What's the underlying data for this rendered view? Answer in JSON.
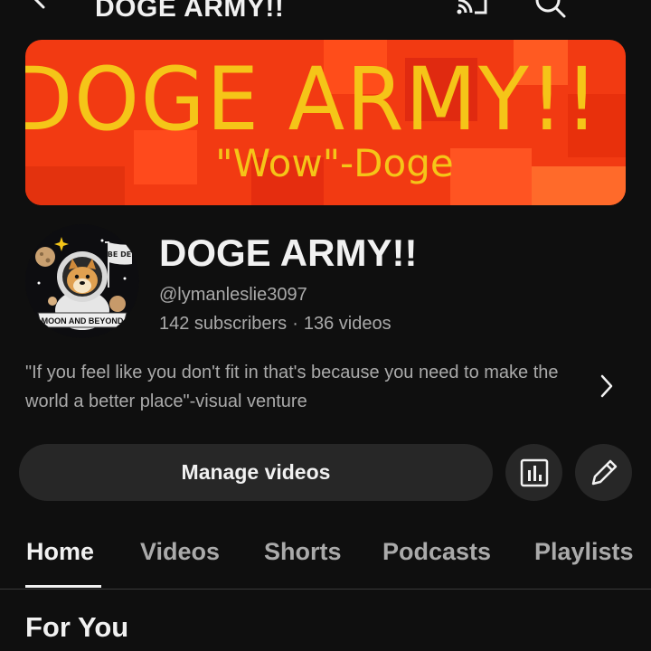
{
  "topbar": {
    "title": "DOGE ARMY!!",
    "icons": [
      "back-arrow-icon",
      "cast-icon",
      "search-icon",
      "more-vertical-icon"
    ]
  },
  "banner": {
    "title": "DOGE ARMY!!",
    "subtitle": "\"Wow\"-Doge",
    "colors": {
      "background": "#f23a12",
      "text": "#f5c518"
    }
  },
  "avatar": {
    "badge_text": "BE DE",
    "ribbon_text": "MOON AND BEYOND"
  },
  "channel": {
    "name": "DOGE ARMY!!",
    "handle": "@lymanleslie3097",
    "subscribers": "142 subscribers",
    "separator": "·",
    "videos": "136 videos",
    "description": "\"If you feel like you don't fit in that's because you need to make the world a better place\"-visual venture"
  },
  "actions": {
    "manage_videos_label": "Manage videos",
    "icons": [
      "analytics-icon",
      "edit-pencil-icon"
    ]
  },
  "tabs": [
    {
      "label": "Home",
      "active": true
    },
    {
      "label": "Videos",
      "active": false
    },
    {
      "label": "Shorts",
      "active": false
    },
    {
      "label": "Podcasts",
      "active": false
    },
    {
      "label": "Playlists",
      "active": false
    }
  ],
  "section": {
    "title": "For You"
  }
}
